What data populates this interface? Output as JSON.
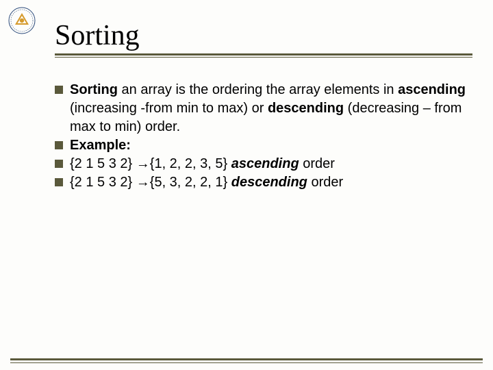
{
  "title": "Sorting",
  "bullets": {
    "b1_lead": "Sorting",
    "b1_rest": " an array is the ordering the array elements in ",
    "b1_asc": "ascending",
    "b1_mid": " (increasing -from min to max) or ",
    "b1_desc": "descending",
    "b1_tail": " (decreasing – from max to min) order.",
    "b2": "Example:",
    "b3_set": "{2 1 5 3 2} ",
    "b3_arrow": "→",
    "b3_res": "{1, 2, 2, 3, 5}  ",
    "b3_kind": "ascending",
    "b3_tail": " order",
    "b4_set": "{2 1 5 3 2} ",
    "b4_arrow": "→",
    "b4_res": "{5, 3, 2, 2, 1}  ",
    "b4_kind": "descending",
    "b4_tail": " order"
  }
}
